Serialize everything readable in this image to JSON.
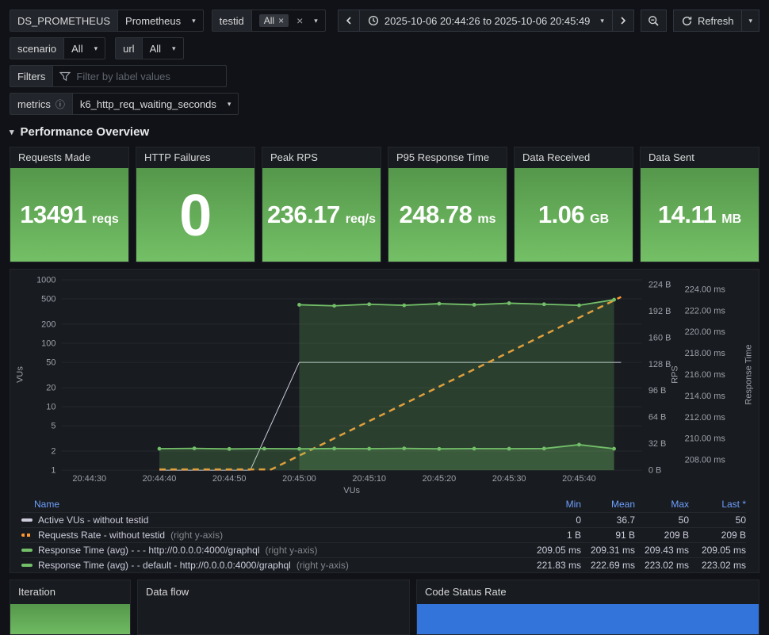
{
  "icons": {
    "chevron_down": "▾",
    "close": "×",
    "info": "ⓘ"
  },
  "toolbar": {
    "ds": {
      "label": "DS_PROMETHEUS",
      "value": "Prometheus"
    },
    "testid": {
      "label": "testid",
      "chip": "All"
    },
    "time_range": "2025-10-06 20:44:26 to 2025-10-06 20:45:49",
    "refresh": "Refresh"
  },
  "variables": {
    "scenario": {
      "label": "scenario",
      "value": "All"
    },
    "url": {
      "label": "url",
      "value": "All"
    },
    "filters": {
      "label": "Filters",
      "placeholder": "Filter by label values"
    },
    "metrics": {
      "label": "metrics",
      "value": "k6_http_req_waiting_seconds"
    }
  },
  "section_title": "Performance Overview",
  "stats": [
    {
      "title": "Requests Made",
      "value": "13491",
      "unit": "reqs"
    },
    {
      "title": "HTTP Failures",
      "value": "0",
      "unit": ""
    },
    {
      "title": "Peak RPS",
      "value": "236.17",
      "unit": "req/s"
    },
    {
      "title": "P95 Response Time",
      "value": "248.78",
      "unit": "ms"
    },
    {
      "title": "Data Received",
      "value": "1.06",
      "unit": "GB"
    },
    {
      "title": "Data Sent",
      "value": "14.11",
      "unit": "MB"
    }
  ],
  "chart_data": {
    "type": "line",
    "x_start": "20:44:26",
    "x_end": "20:45:49",
    "x_ticks": [
      "20:44:30",
      "20:44:40",
      "20:44:50",
      "20:45:00",
      "20:45:10",
      "20:45:20",
      "20:45:30",
      "20:45:40"
    ],
    "xlabel": "VUs",
    "axes": {
      "left": {
        "label": "VUs",
        "scale": "log",
        "min": 1,
        "max": 1000,
        "ticks": [
          "1000",
          "500",
          "200",
          "100",
          "50",
          "20",
          "10",
          "5",
          "2",
          "1"
        ]
      },
      "rps": {
        "label": "RPS",
        "scale": "linear",
        "min": 0,
        "max": 224,
        "ticks": [
          "224 B",
          "192 B",
          "160 B",
          "128 B",
          "96 B",
          "64 B",
          "32 B",
          "0 B"
        ]
      },
      "ms": {
        "label": "Response Time",
        "scale": "linear",
        "min": 208,
        "max": 224,
        "ticks": [
          "224.00 ms",
          "222.00 ms",
          "220.00 ms",
          "218.00 ms",
          "216.00 ms",
          "214.00 ms",
          "212.00 ms",
          "210.00 ms",
          "208.00 ms"
        ]
      }
    },
    "series": [
      {
        "name": "Active VUs - without testid",
        "axis": "left",
        "color": "#ccccdc",
        "width": 1,
        "dash": false,
        "points": false,
        "fill": false,
        "data": [
          [
            "20:44:40",
            1
          ],
          [
            "20:44:53",
            1
          ],
          [
            "20:45:00",
            50
          ],
          [
            "20:45:46",
            50
          ]
        ]
      },
      {
        "name": "Requests Rate - without testid",
        "axis": "rps",
        "color": "#ff9830",
        "width": 2.5,
        "dash": true,
        "points": false,
        "fill": false,
        "data": [
          [
            "20:44:40",
            1
          ],
          [
            "20:44:56",
            1
          ],
          [
            "20:45:46",
            209
          ]
        ]
      },
      {
        "name": "Response Time (avg) - - - http://0.0.0.0:4000/graphql",
        "axis": "ms",
        "color": "#73bf69",
        "width": 1.8,
        "dash": false,
        "points": true,
        "fill": true,
        "data": [
          [
            "20:44:40",
            209.05
          ],
          [
            "20:44:45",
            209.08
          ],
          [
            "20:44:50",
            209.03
          ],
          [
            "20:44:55",
            209.06
          ],
          [
            "20:45:00",
            209.04
          ],
          [
            "20:45:05",
            209.07
          ],
          [
            "20:45:10",
            209.05
          ],
          [
            "20:45:15",
            209.08
          ],
          [
            "20:45:20",
            209.04
          ],
          [
            "20:45:25",
            209.06
          ],
          [
            "20:45:30",
            209.05
          ],
          [
            "20:45:35",
            209.07
          ],
          [
            "20:45:40",
            209.43
          ],
          [
            "20:45:45",
            209.05
          ]
        ]
      },
      {
        "name": "Response Time (avg) - - default - http://0.0.0.0:4000/graphql",
        "axis": "ms",
        "color": "#73bf69",
        "width": 1.8,
        "dash": false,
        "points": true,
        "fill": true,
        "data": [
          [
            "20:45:00",
            222.55
          ],
          [
            "20:45:05",
            222.45
          ],
          [
            "20:45:10",
            222.6
          ],
          [
            "20:45:15",
            222.5
          ],
          [
            "20:45:20",
            222.65
          ],
          [
            "20:45:25",
            222.55
          ],
          [
            "20:45:30",
            222.7
          ],
          [
            "20:45:35",
            222.6
          ],
          [
            "20:45:40",
            222.5
          ],
          [
            "20:45:45",
            223.02
          ]
        ]
      }
    ]
  },
  "legend": {
    "columns": {
      "name": "Name",
      "min": "Min",
      "mean": "Mean",
      "max": "Max",
      "last": "Last *"
    },
    "rows": [
      {
        "name": "Active VUs - without testid",
        "suffix": "",
        "min": "0",
        "mean": "36.7",
        "max": "50",
        "last": "50"
      },
      {
        "name": "Requests Rate - without testid",
        "suffix": "(right y-axis)",
        "min": "1 B",
        "mean": "91 B",
        "max": "209 B",
        "last": "209 B"
      },
      {
        "name": "Response Time (avg) - - - http://0.0.0.0:4000/graphql",
        "suffix": "(right y-axis)",
        "min": "209.05 ms",
        "mean": "209.31 ms",
        "max": "209.43 ms",
        "last": "209.05 ms"
      },
      {
        "name": "Response Time (avg) - - default - http://0.0.0.0:4000/graphql",
        "suffix": "(right y-axis)",
        "min": "221.83 ms",
        "mean": "222.69 ms",
        "max": "223.02 ms",
        "last": "223.02 ms"
      }
    ]
  },
  "bottom_panels": [
    {
      "title": "Iteration"
    },
    {
      "title": "Data flow"
    },
    {
      "title": "Code Status Rate"
    }
  ]
}
